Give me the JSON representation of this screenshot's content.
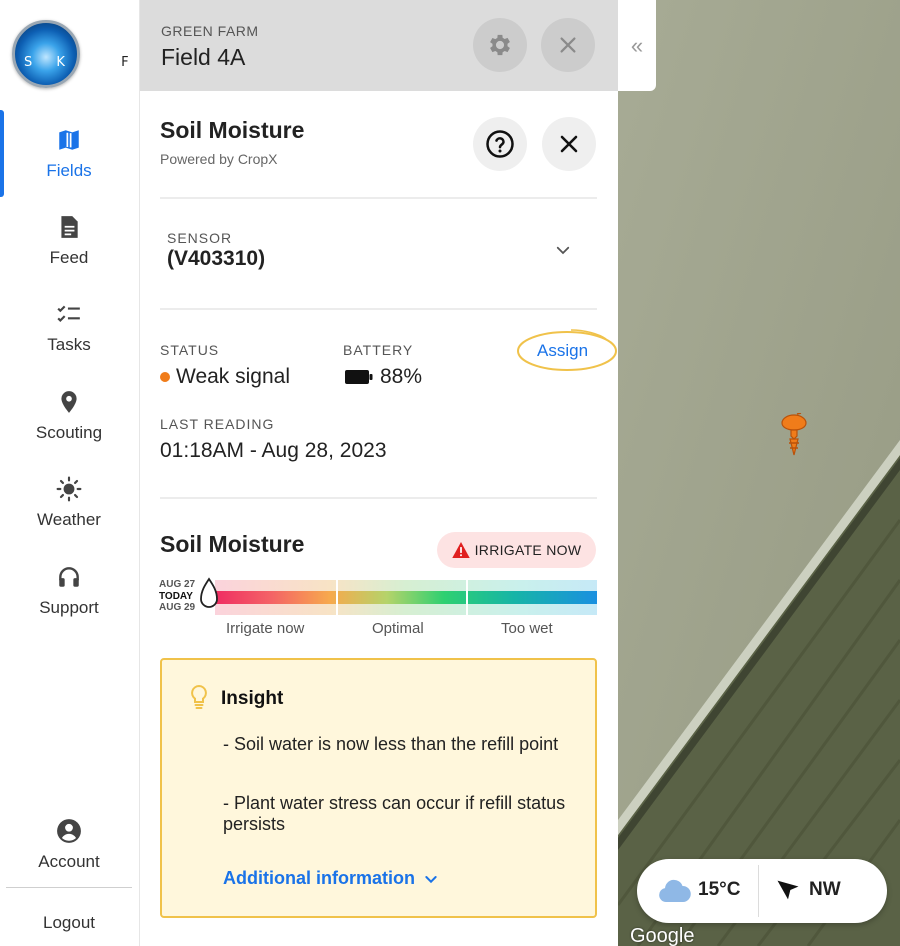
{
  "app": {
    "logo_text": "SKYFLD",
    "logo_light": "S K Y",
    "logo_dark": " F L D"
  },
  "nav": {
    "items": [
      {
        "label": "Fields",
        "icon": "map-icon",
        "active": true
      },
      {
        "label": "Feed",
        "icon": "document-icon"
      },
      {
        "label": "Tasks",
        "icon": "checklist-icon"
      },
      {
        "label": "Scouting",
        "icon": "location-pin-icon"
      },
      {
        "label": "Weather",
        "icon": "sun-icon"
      },
      {
        "label": "Support",
        "icon": "headset-icon"
      }
    ],
    "account": "Account",
    "logout": "Logout"
  },
  "header": {
    "farm": "GREEN FARM",
    "field": "Field 4A"
  },
  "panel": {
    "title": "Soil Moisture",
    "subtitle": "Powered by CropX",
    "sensor_label": "SENSOR",
    "sensor_value": "(V403310)",
    "status_label": "STATUS",
    "status_value": "Weak signal",
    "battery_label": "BATTERY",
    "battery_value": "88%",
    "assign": "Assign",
    "last_reading_label": "LAST READING",
    "last_reading_value": "01:18AM - Aug 28, 2023",
    "moisture_title": "Soil Moisture",
    "irrigate_badge": "IRRIGATE NOW",
    "dates": {
      "before": "AUG 27",
      "today": "TODAY",
      "after": "AUG 29"
    },
    "zones": [
      "Irrigate now",
      "Optimal",
      "Too wet"
    ],
    "insight": {
      "title": "Insight",
      "items": [
        "- Soil water is now less than the refill point",
        "- Plant water stress can occur if refill status persists"
      ],
      "link": "Additional information"
    }
  },
  "map": {
    "temperature": "15°C",
    "wind": "NW",
    "attribution": "Google"
  },
  "colors": {
    "accent": "#1a73e8",
    "status_dot": "#f07c1a",
    "alert": "#e02020",
    "highlight": "#f0c24a"
  }
}
